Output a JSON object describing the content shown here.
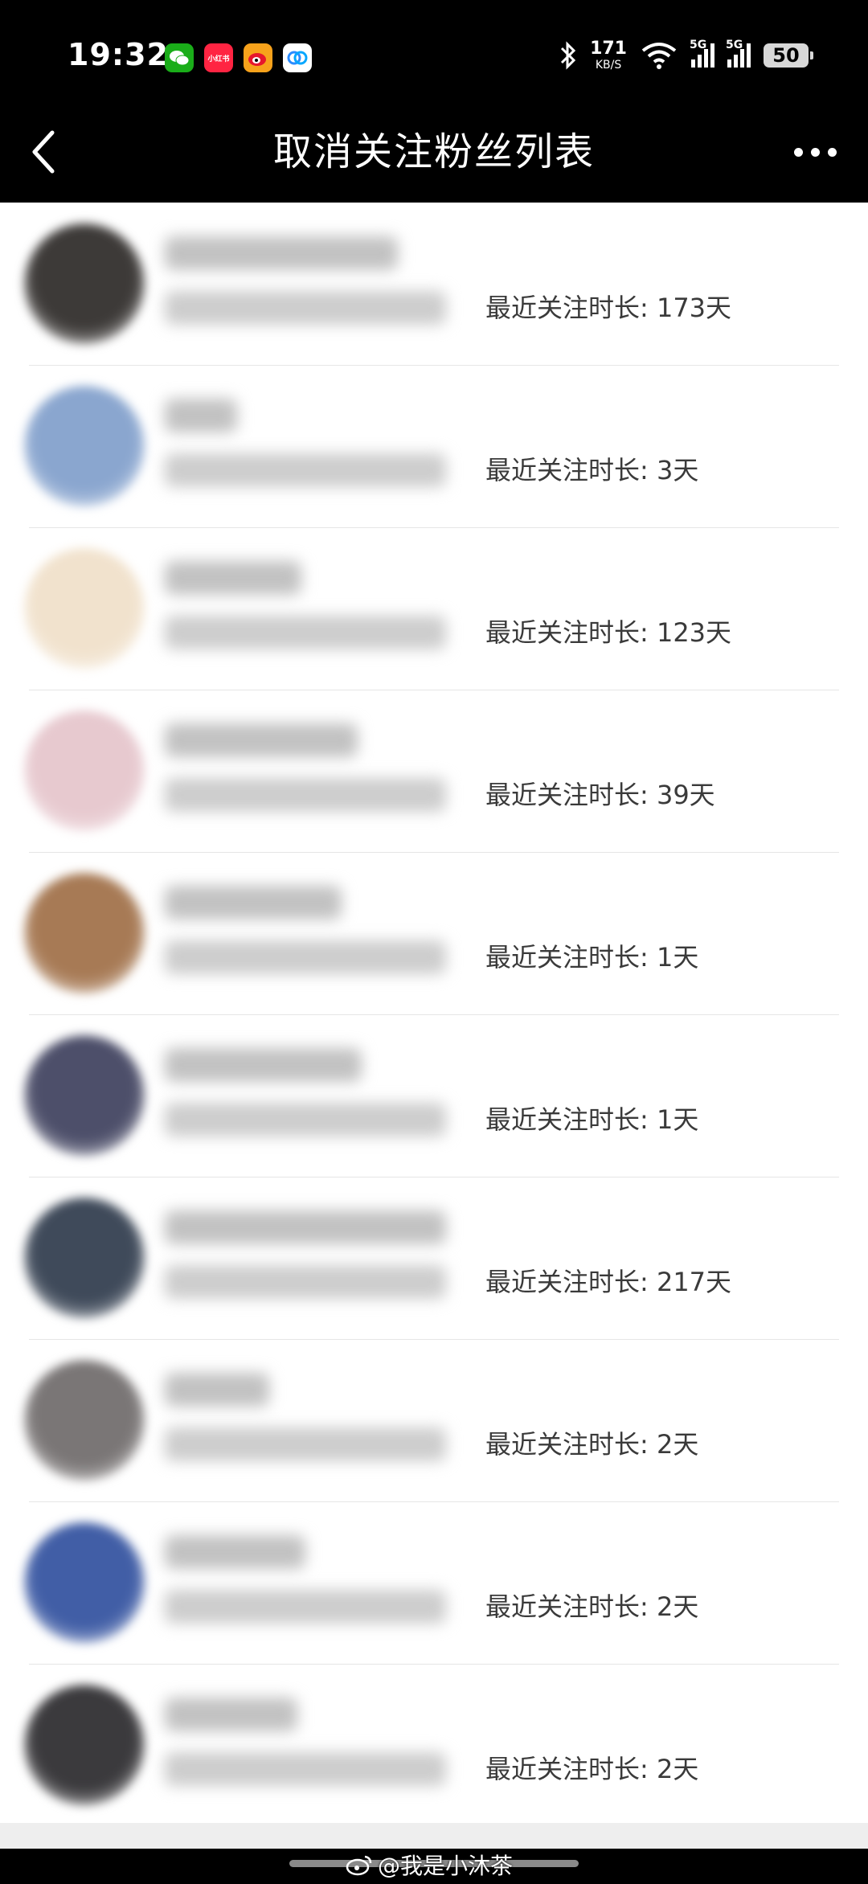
{
  "status_bar": {
    "time": "19:32",
    "apps": [
      {
        "name": "wechat-icon",
        "label": ""
      },
      {
        "name": "xiaohongshu-icon",
        "label": "小红书"
      },
      {
        "name": "weibo-icon",
        "label": ""
      },
      {
        "name": "baidu-netdisk-icon",
        "label": ""
      }
    ],
    "net_speed": "171",
    "net_unit": "KB/S",
    "signal1": "5G",
    "signal2": "5G",
    "battery": "50"
  },
  "header": {
    "title": "取消关注粉丝列表"
  },
  "list": {
    "items": [
      {
        "duration": "最近关注时长: 173天",
        "avatar_color": "#3d3a38"
      },
      {
        "duration": "最近关注时长: 3天",
        "avatar_color": "#8aa6cf"
      },
      {
        "duration": "最近关注时长: 123天",
        "avatar_color": "#f1e2cd"
      },
      {
        "duration": "最近关注时长: 39天",
        "avatar_color": "#e7c9cf"
      },
      {
        "duration": "最近关注时长: 1天",
        "avatar_color": "#a77a55"
      },
      {
        "duration": "最近关注时长: 1天",
        "avatar_color": "#4d4f6a"
      },
      {
        "duration": "最近关注时长: 217天",
        "avatar_color": "#3f4a5a"
      },
      {
        "duration": "最近关注时长: 2天",
        "avatar_color": "#7a7676"
      },
      {
        "duration": "最近关注时长: 2天",
        "avatar_color": "#415ea6"
      },
      {
        "duration": "最近关注时长: 2天",
        "avatar_color": "#3b3a3d"
      }
    ]
  },
  "watermark": "@我是小沐茶"
}
